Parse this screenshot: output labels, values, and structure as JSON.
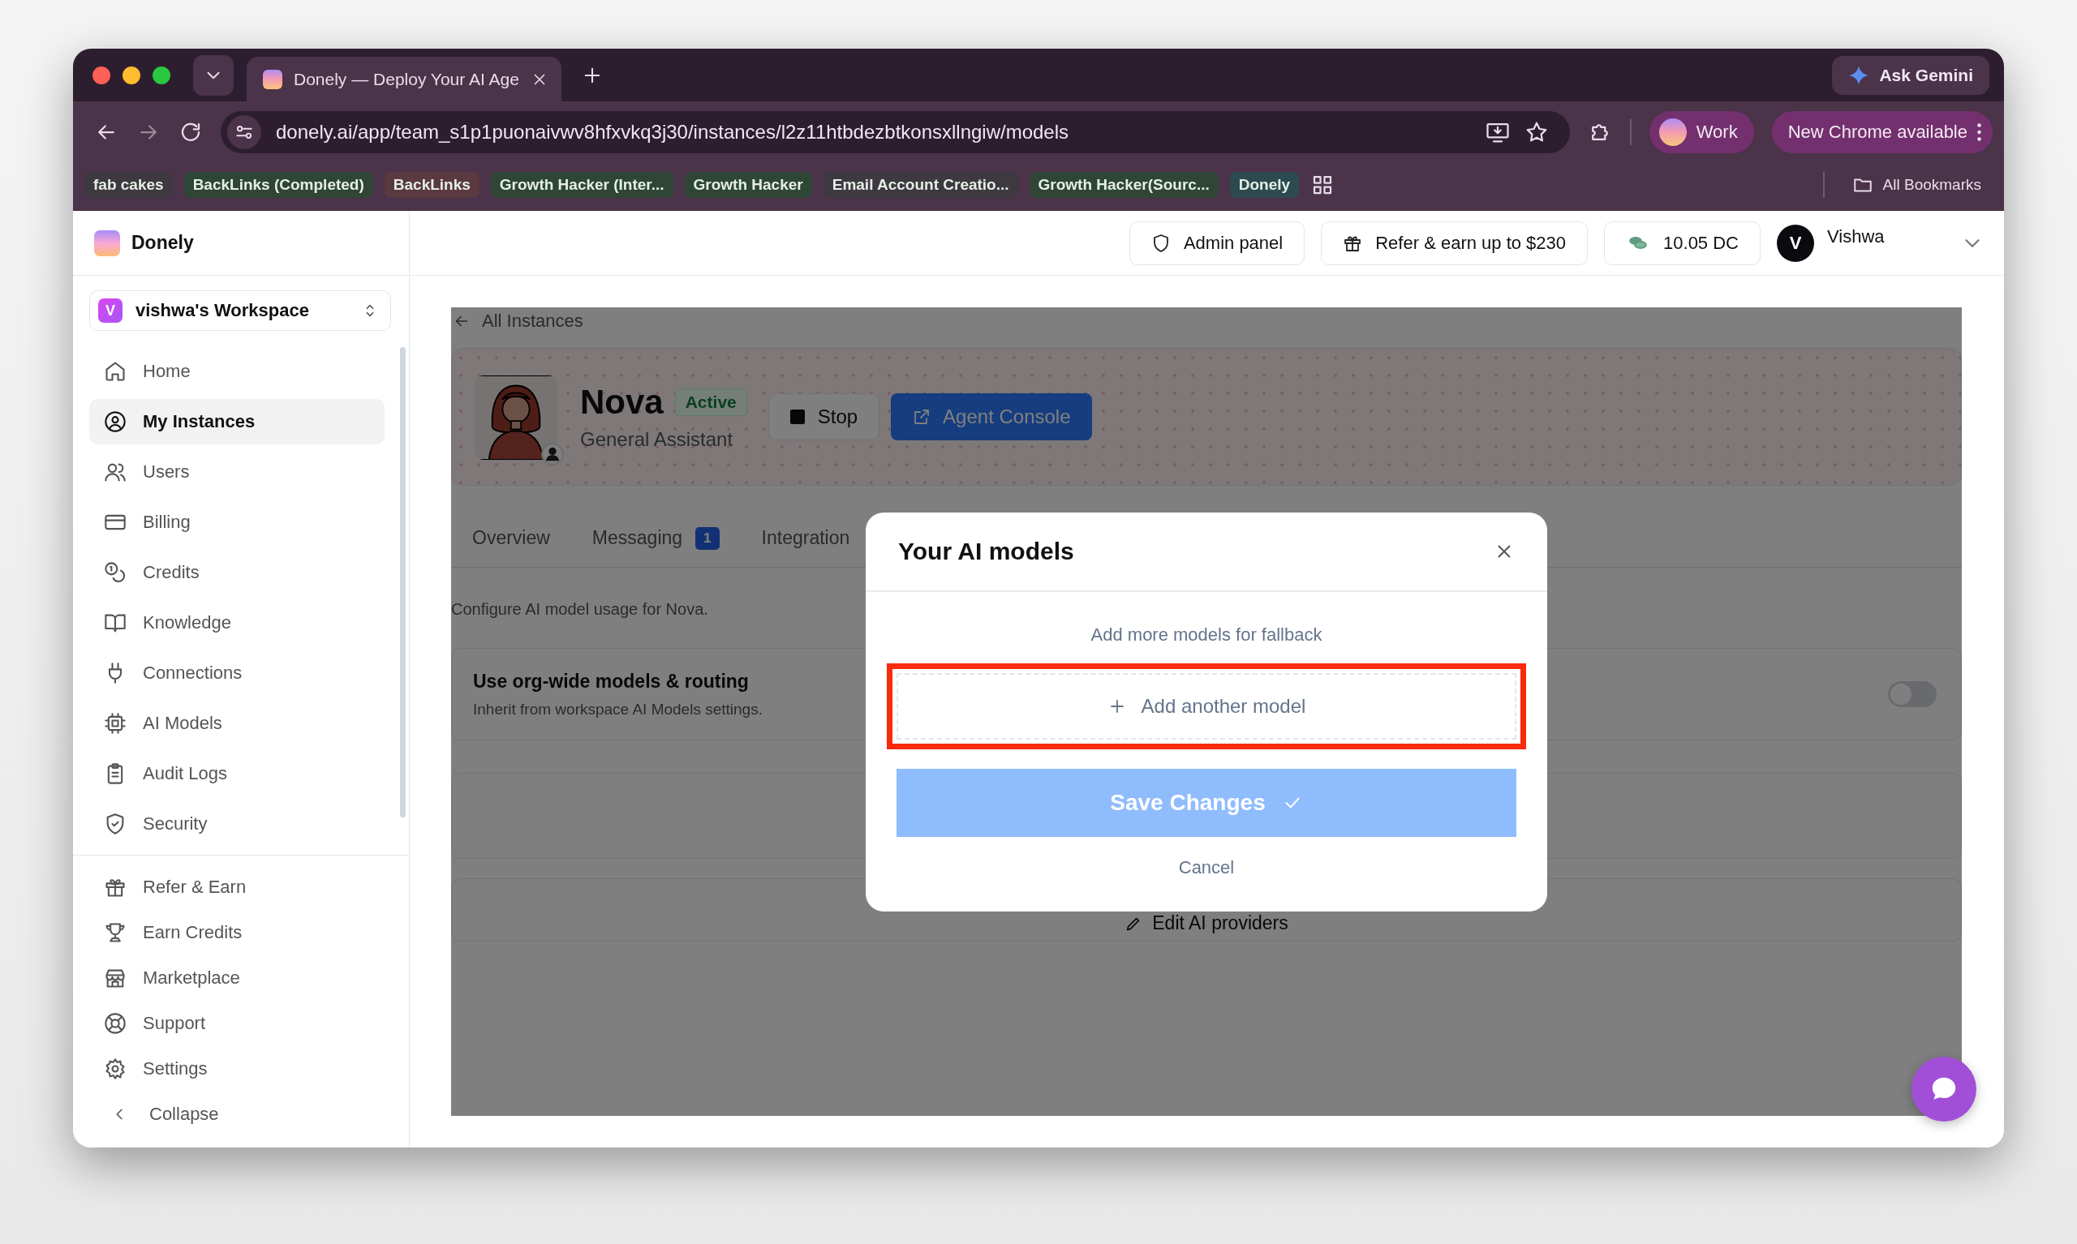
{
  "browser": {
    "tabs": [
      {
        "title": "Donely — Deploy Your AI Age",
        "selected": true
      }
    ],
    "ask_gemini": "Ask Gemini",
    "url": "donely.ai/app/team_s1p1puonaivwv8hfxvkq3j30/instances/l2z11htbdezbtkonsxllngiw/models",
    "profile": "Work",
    "update_button": "New Chrome available",
    "bookmarks": [
      {
        "label": "fab cakes",
        "color": "#3e3940"
      },
      {
        "label": "BackLinks (Completed)",
        "color": "#2f4535"
      },
      {
        "label": "BackLinks",
        "color": "#5a3a40"
      },
      {
        "label": "Growth Hacker (Inter...",
        "color": "#2f4535"
      },
      {
        "label": "Growth Hacker",
        "color": "#2f4535"
      },
      {
        "label": "Email Account Creatio...",
        "color": "#3e3940"
      },
      {
        "label": "Growth Hacker(Sourc...",
        "color": "#2f4535"
      },
      {
        "label": "Donely",
        "color": "#2c4a4f"
      }
    ],
    "all_bookmarks": "All Bookmarks"
  },
  "app": {
    "brand": "Donely",
    "workspace": {
      "initial": "V",
      "name": "vishwa's Workspace"
    },
    "nav": [
      {
        "label": "Home",
        "selected": false
      },
      {
        "label": "My Instances",
        "selected": true
      },
      {
        "label": "Users",
        "selected": false
      },
      {
        "label": "Billing",
        "selected": false
      },
      {
        "label": "Credits",
        "selected": false
      },
      {
        "label": "Knowledge",
        "selected": false
      },
      {
        "label": "Connections",
        "selected": false
      },
      {
        "label": "AI Models",
        "selected": false
      },
      {
        "label": "Audit Logs",
        "selected": false
      },
      {
        "label": "Security",
        "selected": false
      }
    ],
    "nav_bottom": [
      {
        "label": "Refer & Earn",
        "selected": false
      },
      {
        "label": "Earn Credits",
        "selected": false
      },
      {
        "label": "Marketplace",
        "selected": false
      },
      {
        "label": "Support",
        "selected": false
      },
      {
        "label": "Settings",
        "selected": false
      }
    ],
    "collapse": "Collapse"
  },
  "header": {
    "admin_panel": "Admin panel",
    "refer": "Refer & earn up to $230",
    "credits": "10.05 DC",
    "user": {
      "initial": "V",
      "name": "Vishwa"
    }
  },
  "page": {
    "back": "All Instances",
    "instance": {
      "name": "Nova",
      "status": "Active",
      "role": "General Assistant"
    },
    "stop": "Stop",
    "console": "Agent Console",
    "tabs": [
      {
        "label": "Overview",
        "selected": false
      },
      {
        "label": "Messaging",
        "badge": "1",
        "selected": false
      },
      {
        "label": "Integration",
        "selected": false
      }
    ],
    "description": "Configure AI model usage for Nova.",
    "org_routing": {
      "title": "Use org-wide models & routing",
      "subtitle": "Inherit from workspace AI Models settings.",
      "on": false
    },
    "edit_providers": "Edit AI providers"
  },
  "modal": {
    "title": "Your AI models",
    "hint": "Add more models for fallback",
    "add_model": {
      "label": "Add another model",
      "highlighted": true
    },
    "save": "Save Changes",
    "cancel": "Cancel"
  }
}
